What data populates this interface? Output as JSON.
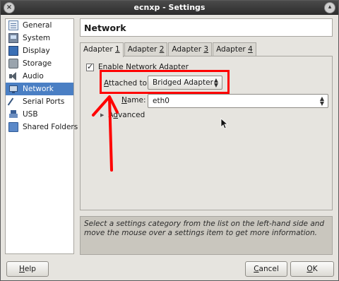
{
  "window": {
    "title": "ecnxp - Settings"
  },
  "sidebar": {
    "items": [
      {
        "label": "General",
        "icon": "general-icon"
      },
      {
        "label": "System",
        "icon": "system-icon"
      },
      {
        "label": "Display",
        "icon": "display-icon"
      },
      {
        "label": "Storage",
        "icon": "storage-icon"
      },
      {
        "label": "Audio",
        "icon": "audio-icon"
      },
      {
        "label": "Network",
        "icon": "network-icon",
        "selected": true
      },
      {
        "label": "Serial Ports",
        "icon": "serial-ports-icon"
      },
      {
        "label": "USB",
        "icon": "usb-icon"
      },
      {
        "label": "Shared Folders",
        "icon": "shared-folders-icon"
      }
    ]
  },
  "main": {
    "heading": "Network",
    "tabs": [
      {
        "label": "Adapter ",
        "accel": "1",
        "active": true
      },
      {
        "label": "Adapter ",
        "accel": "2"
      },
      {
        "label": "Adapter ",
        "accel": "3"
      },
      {
        "label": "Adapter ",
        "accel": "4"
      }
    ],
    "enable_adapter": {
      "label": "Enable Network Adapter",
      "checked": true
    },
    "attached_to": {
      "label_accel": "A",
      "label_rest": "ttached to:",
      "value": "Bridged Adapter"
    },
    "name": {
      "label_accel": "N",
      "label_rest": "ame:",
      "value": "eth0"
    },
    "advanced": {
      "label_accel": "d",
      "label_pre": "A",
      "label_rest": "vanced"
    }
  },
  "info": {
    "text": "Select a settings category from the list on the left-hand side and move the mouse over a settings item to get more information."
  },
  "buttons": {
    "help": {
      "accel": "H",
      "rest": "elp"
    },
    "cancel": {
      "accel": "C",
      "rest": "ancel"
    },
    "ok": {
      "accel": "O",
      "rest": "K"
    }
  },
  "colors": {
    "annotation": "#ff0000",
    "selection": "#4a7fc4"
  }
}
